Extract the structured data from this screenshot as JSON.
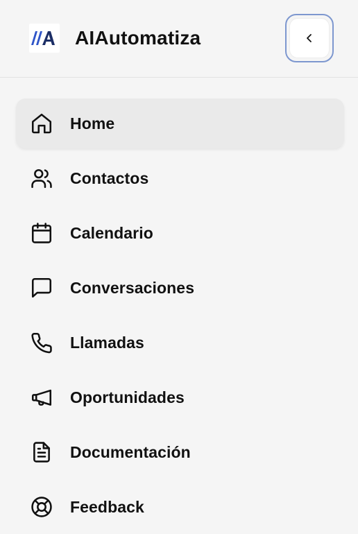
{
  "header": {
    "brand_name": "AIAutomatiza",
    "logo_icon": "aiautomatiza-logo",
    "collapse_icon": "chevron-left-icon"
  },
  "colors": {
    "background": "#f5f5f5",
    "active_item_bg": "#eaeaea",
    "focus_ring": "#7d97cf",
    "logo_blue": "#2f55c8",
    "logo_dark": "#1c2e66",
    "text": "#111111"
  },
  "nav": {
    "active_index": 0,
    "items": [
      {
        "label": "Home",
        "icon": "home-icon"
      },
      {
        "label": "Contactos",
        "icon": "users-icon"
      },
      {
        "label": "Calendario",
        "icon": "calendar-icon"
      },
      {
        "label": "Conversaciones",
        "icon": "message-square-icon"
      },
      {
        "label": "Llamadas",
        "icon": "phone-icon"
      },
      {
        "label": "Oportunidades",
        "icon": "megaphone-icon"
      },
      {
        "label": "Documentación",
        "icon": "file-text-icon"
      },
      {
        "label": "Feedback",
        "icon": "life-buoy-icon"
      }
    ]
  }
}
